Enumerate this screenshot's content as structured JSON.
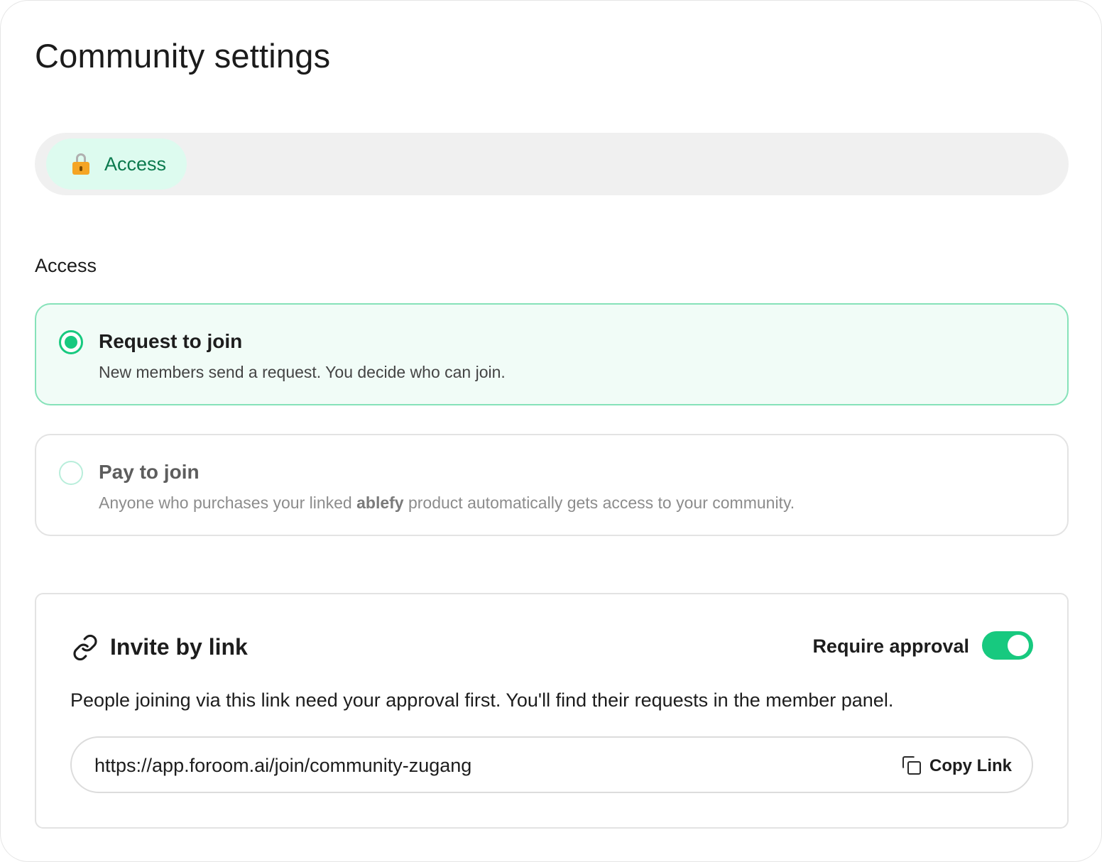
{
  "page": {
    "title": "Community settings"
  },
  "tabs": [
    {
      "label": "Access",
      "icon": "lock-icon",
      "active": true,
      "accent": "#0b7a4e"
    }
  ],
  "access": {
    "section_label": "Access",
    "options": [
      {
        "title": "Request to join",
        "description": "New members send a request. You decide who can join.",
        "selected": true
      },
      {
        "title": "Pay to join",
        "description_before": "Anyone who purchases your linked ",
        "description_bold": "ablefy",
        "description_after": " product automatically gets access to your community.",
        "selected": false
      }
    ]
  },
  "invite": {
    "title": "Invite by link",
    "icon": "link-icon",
    "require_approval_label": "Require approval",
    "require_approval_on": true,
    "description": "People joining via this link need your approval first. You'll find their requests in the member panel.",
    "url": "https://app.foroom.ai/join/community-zugang",
    "copy_label": "Copy Link",
    "copy_icon": "copy-icon"
  },
  "colors": {
    "accent_green": "#17c97f",
    "selected_bg": "#f1fcf7",
    "selected_border": "#86e2b9",
    "tab_bg": "#ddfbef"
  }
}
